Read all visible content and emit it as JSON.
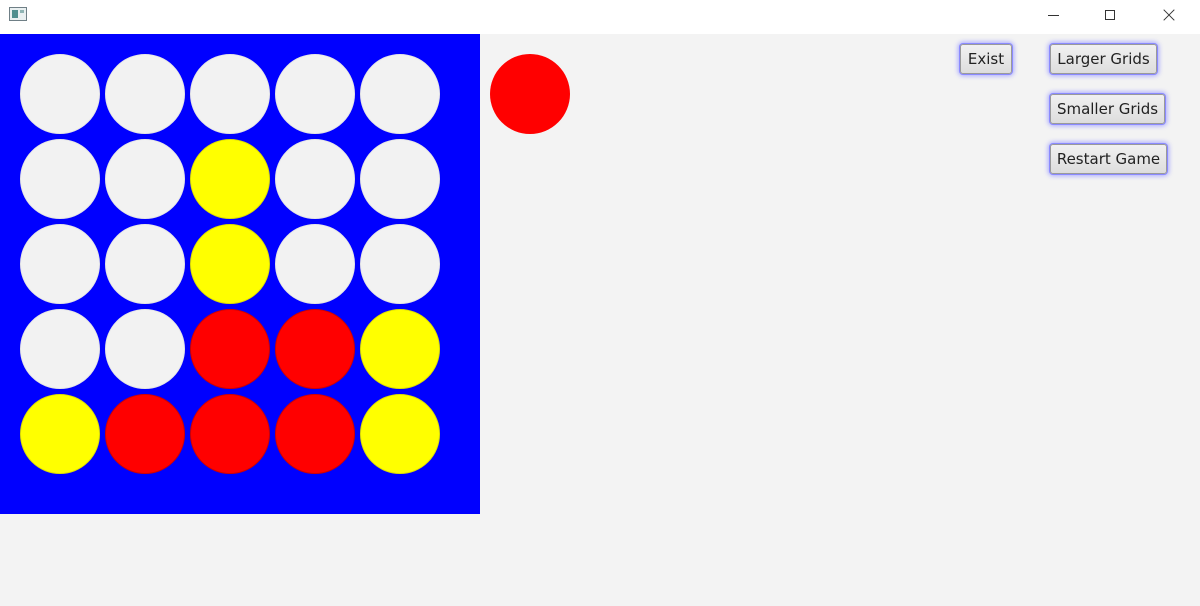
{
  "titlebar": {
    "app_icon": "window-app-icon",
    "controls": [
      "minimize-icon",
      "maximize-icon",
      "close-icon"
    ]
  },
  "colors": {
    "board": "#0000ff",
    "empty": "#f2f2f2",
    "red": "#ff0000",
    "yellow": "#ffff00",
    "background": "#f3f3f3"
  },
  "board": {
    "rows": 5,
    "cols": 5,
    "cells": [
      [
        "empty",
        "empty",
        "empty",
        "empty",
        "empty"
      ],
      [
        "empty",
        "empty",
        "yellow",
        "empty",
        "empty"
      ],
      [
        "empty",
        "empty",
        "yellow",
        "empty",
        "empty"
      ],
      [
        "empty",
        "empty",
        "red",
        "red",
        "yellow"
      ],
      [
        "yellow",
        "red",
        "red",
        "red",
        "yellow"
      ]
    ]
  },
  "current_player": "red",
  "buttons": {
    "exist": "Exist",
    "larger": "Larger Grids",
    "smaller": "Smaller Grids",
    "restart": "Restart Game"
  }
}
